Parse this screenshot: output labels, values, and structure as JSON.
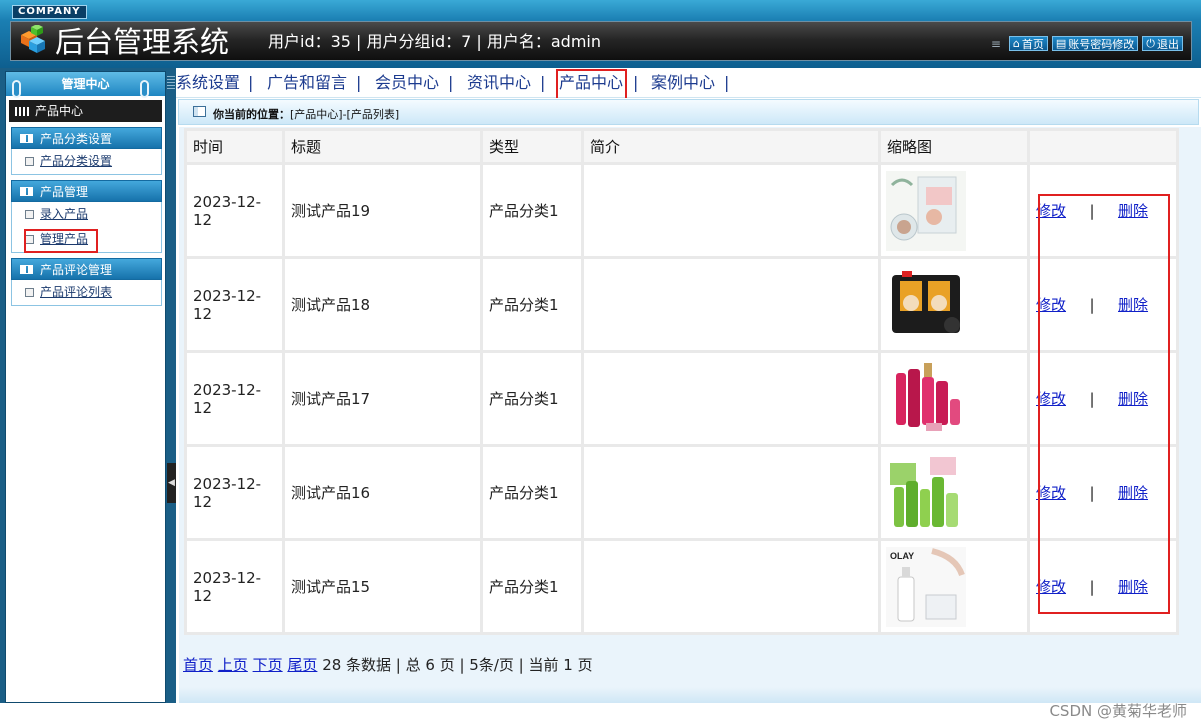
{
  "header": {
    "company": "COMPANY",
    "title": "后台管理系统",
    "user_info": "用户id：35 | 用户分组id：7 | 用户名：admin",
    "actions": [
      {
        "label": "首页",
        "icon": "home-icon"
      },
      {
        "label": "账号密码修改",
        "icon": "form-icon"
      },
      {
        "label": "退出",
        "icon": "power-icon"
      }
    ]
  },
  "sidebar": {
    "title": "管理中心",
    "section": "产品中心",
    "groups": [
      {
        "title": "产品分类设置",
        "items": [
          "产品分类设置"
        ]
      },
      {
        "title": "产品管理",
        "items": [
          "录入产品",
          "管理产品"
        ]
      },
      {
        "title": "产品评论管理",
        "items": [
          "产品评论列表"
        ]
      }
    ]
  },
  "nav": {
    "items": [
      "系统设置",
      "广告和留言",
      "会员中心",
      "资讯中心",
      "产品中心",
      "案例中心"
    ],
    "separator": "|"
  },
  "breadcrumb": {
    "label": "你当前的位置：",
    "path": "[产品中心]-[产品列表]"
  },
  "table": {
    "headers": [
      "时间",
      "标题",
      "类型",
      "简介",
      "缩略图",
      ""
    ],
    "rows": [
      {
        "date_line1": "2023-12-",
        "date_line2": "12",
        "title": "测试产品19",
        "type": "产品分类1",
        "intro": "",
        "thumb": "face-mask-pack"
      },
      {
        "date_line1": "2023-12-",
        "date_line2": "12",
        "title": "测试产品18",
        "type": "产品分类1",
        "intro": "",
        "thumb": "black-mask-pack"
      },
      {
        "date_line1": "2023-12-",
        "date_line2": "12",
        "title": "测试产品17",
        "type": "产品分类1",
        "intro": "",
        "thumb": "red-cosmetics-set"
      },
      {
        "date_line1": "2023-12-",
        "date_line2": "12",
        "title": "测试产品16",
        "type": "产品分类1",
        "intro": "",
        "thumb": "green-skincare-set"
      },
      {
        "date_line1": "2023-12-",
        "date_line2": "12",
        "title": "测试产品15",
        "type": "产品分类1",
        "intro": "",
        "thumb": "olay-serum"
      }
    ],
    "edit_label": "修改",
    "delete_label": "删除",
    "action_sep": "|"
  },
  "pager": {
    "first": "首页",
    "prev": "上页",
    "next": "下页",
    "last": "尾页",
    "summary": "28 条数据 | 总 6 页 | 5条/页 | 当前 1 页"
  },
  "watermark": "CSDN @黄菊华老师",
  "colors": {
    "header_blue": "#1b7fb3",
    "highlight_red": "#e02020",
    "link_blue": "#1020c8"
  }
}
